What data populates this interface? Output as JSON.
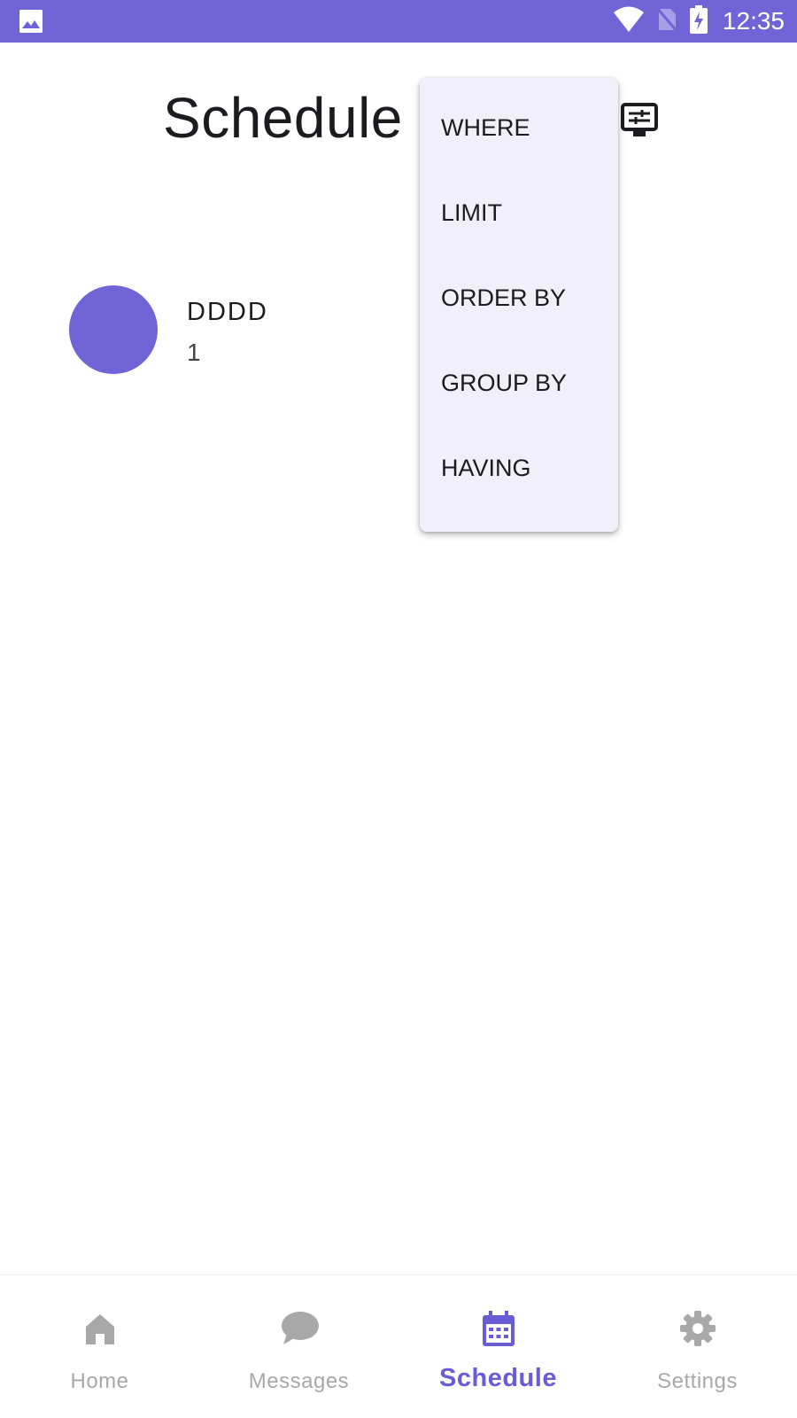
{
  "status_bar": {
    "time": "12:35",
    "icons": [
      "image-icon",
      "wifi-icon",
      "no-sim-icon",
      "battery-charging-icon"
    ]
  },
  "header": {
    "title": "Schedule",
    "filter_icon": "filter-icon"
  },
  "list": {
    "items": [
      {
        "title": "DDDD",
        "subtitle": "1"
      }
    ]
  },
  "menu": {
    "items": [
      {
        "label": "WHERE"
      },
      {
        "label": "LIMIT"
      },
      {
        "label": "ORDER BY"
      },
      {
        "label": "GROUP BY"
      },
      {
        "label": "HAVING"
      }
    ]
  },
  "bottom_nav": {
    "items": [
      {
        "label": "Home",
        "icon": "home-icon",
        "active": false
      },
      {
        "label": "Messages",
        "icon": "chat-icon",
        "active": false
      },
      {
        "label": "Schedule",
        "icon": "calendar-icon",
        "active": true
      },
      {
        "label": "Settings",
        "icon": "gear-icon",
        "active": false
      }
    ]
  },
  "colors": {
    "accent": "#7164d6",
    "inactive": "#a8a8a8",
    "menu_bg": "#f1eff9"
  }
}
